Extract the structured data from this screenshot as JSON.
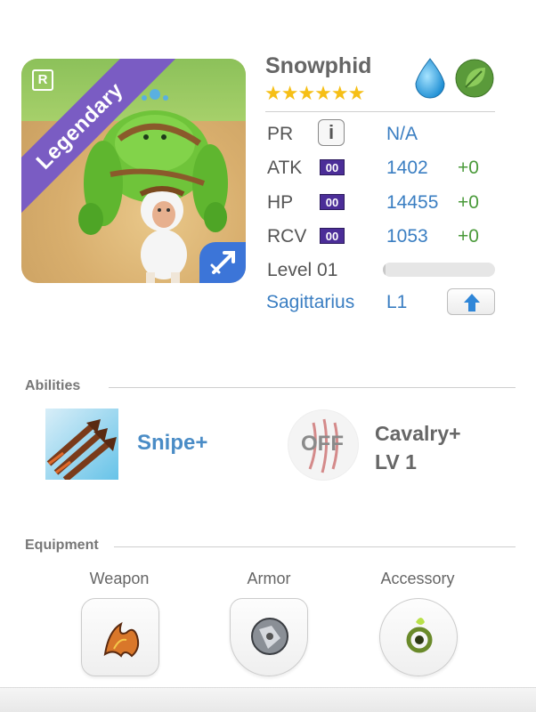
{
  "monster": {
    "name": "Snowphid",
    "rarity_label": "Legendary",
    "rarity_badge": "R",
    "stars": "★★★★★★",
    "elements": [
      "water-drop-icon",
      "leaf-icon"
    ],
    "class_icon": "sagittarius-arrow-icon"
  },
  "stats": {
    "pr": {
      "label": "PR",
      "value": "N/A",
      "info_icon": "i"
    },
    "atk": {
      "label": "ATK",
      "tag": "00",
      "value": "1402",
      "bonus": "+0"
    },
    "hp": {
      "label": "HP",
      "tag": "00",
      "value": "14455",
      "bonus": "+0"
    },
    "rcv": {
      "label": "RCV",
      "tag": "00",
      "value": "1053",
      "bonus": "+0"
    },
    "level": {
      "label": "Level 01",
      "progress": 0.02
    },
    "sign": {
      "label": "Sagittarius",
      "level": "L1",
      "upgrade_icon": "up-arrow-icon"
    }
  },
  "abilities": {
    "title": "Abilities",
    "skill": {
      "name": "Snipe+",
      "icon": "triple-arrow-icon"
    },
    "awoken": {
      "state": "OFF",
      "name": "Cavalry+",
      "level": "LV 1",
      "icon": "claw-icon"
    }
  },
  "equipment": {
    "title": "Equipment",
    "slots": [
      {
        "label": "Weapon",
        "icon": "flame-claw-icon"
      },
      {
        "label": "Armor",
        "icon": "silver-armor-icon"
      },
      {
        "label": "Accessory",
        "icon": "green-ring-icon"
      }
    ]
  },
  "colors": {
    "legendary_purple": "#7a5cc3",
    "link_blue": "#3a7ec2",
    "bonus_green": "#4a9a3a",
    "star_gold": "#f6bf16",
    "tag_purple": "#4b2d98"
  }
}
